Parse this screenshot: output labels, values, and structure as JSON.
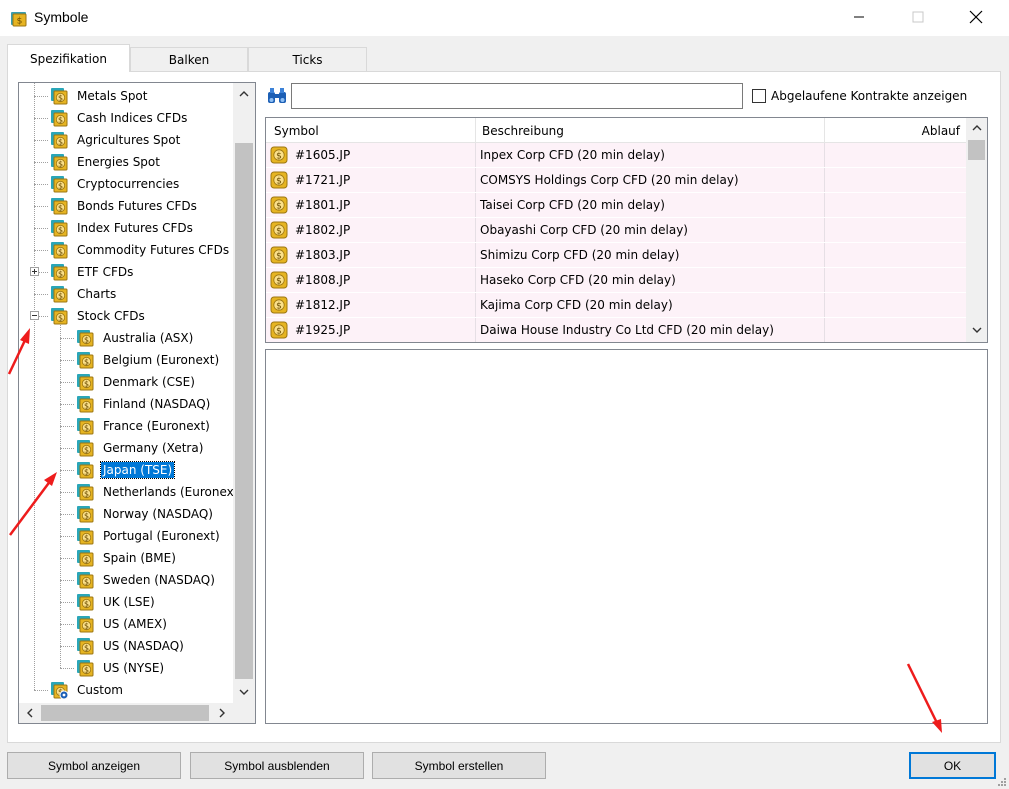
{
  "window": {
    "title": "Symbole"
  },
  "tabs": [
    {
      "label": "Spezifikation",
      "active": true
    },
    {
      "label": "Balken",
      "active": false
    },
    {
      "label": "Ticks",
      "active": false
    }
  ],
  "tree": {
    "items": [
      {
        "label": "Metals Spot",
        "level": 0
      },
      {
        "label": "Cash Indices CFDs",
        "level": 0
      },
      {
        "label": "Agricultures Spot",
        "level": 0
      },
      {
        "label": "Energies Spot",
        "level": 0
      },
      {
        "label": "Cryptocurrencies",
        "level": 0
      },
      {
        "label": "Bonds Futures CFDs",
        "level": 0
      },
      {
        "label": "Index Futures CFDs",
        "level": 0
      },
      {
        "label": "Commodity Futures CFDs",
        "level": 0
      },
      {
        "label": "ETF CFDs",
        "level": 0,
        "expander": "plus"
      },
      {
        "label": "Charts",
        "level": 0
      },
      {
        "label": "Stock CFDs",
        "level": 0,
        "expander": "minus"
      },
      {
        "label": "Australia (ASX)",
        "level": 1
      },
      {
        "label": "Belgium (Euronext)",
        "level": 1
      },
      {
        "label": "Denmark (CSE)",
        "level": 1
      },
      {
        "label": "Finland (NASDAQ)",
        "level": 1
      },
      {
        "label": "France (Euronext)",
        "level": 1
      },
      {
        "label": "Germany (Xetra)",
        "level": 1
      },
      {
        "label": "Japan (TSE)",
        "level": 1,
        "selected": true
      },
      {
        "label": "Netherlands (Euronext)",
        "level": 1
      },
      {
        "label": "Norway (NASDAQ)",
        "level": 1
      },
      {
        "label": "Portugal (Euronext)",
        "level": 1
      },
      {
        "label": "Spain (BME)",
        "level": 1
      },
      {
        "label": "Sweden (NASDAQ)",
        "level": 1
      },
      {
        "label": "UK (LSE)",
        "level": 1
      },
      {
        "label": "US (AMEX)",
        "level": 1
      },
      {
        "label": "US (NASDAQ)",
        "level": 1
      },
      {
        "label": "US (NYSE)",
        "level": 1
      },
      {
        "label": "Custom",
        "level": 0,
        "custom": true
      }
    ]
  },
  "search": {
    "value": "",
    "placeholder": ""
  },
  "expired_checkbox": {
    "label": "Abgelaufene Kontrakte anzeigen",
    "checked": false
  },
  "grid": {
    "columns": [
      "Symbol",
      "Beschreibung",
      "Ablauf"
    ],
    "rows": [
      {
        "symbol": "#1605.JP",
        "description": "Inpex Corp CFD (20 min delay)",
        "expiry": ""
      },
      {
        "symbol": "#1721.JP",
        "description": "COMSYS Holdings Corp CFD (20 min delay)",
        "expiry": ""
      },
      {
        "symbol": "#1801.JP",
        "description": "Taisei Corp CFD (20 min delay)",
        "expiry": ""
      },
      {
        "symbol": "#1802.JP",
        "description": "Obayashi Corp CFD (20 min delay)",
        "expiry": ""
      },
      {
        "symbol": "#1803.JP",
        "description": "Shimizu Corp CFD (20 min delay)",
        "expiry": ""
      },
      {
        "symbol": "#1808.JP",
        "description": "Haseko Corp CFD (20 min delay)",
        "expiry": ""
      },
      {
        "symbol": "#1812.JP",
        "description": "Kajima Corp CFD (20 min delay)",
        "expiry": ""
      },
      {
        "symbol": "#1925.JP",
        "description": "Daiwa House Industry Co Ltd CFD (20 min delay)",
        "expiry": ""
      }
    ]
  },
  "buttons": {
    "show_symbol": "Symbol anzeigen",
    "hide_symbol": "Symbol ausblenden",
    "create_symbol": "Symbol erstellen",
    "ok": "OK"
  },
  "icons": {
    "folder": "folder-dollar-icon",
    "symbol": "dollar-coin-icon",
    "search": "binoculars-icon",
    "custom": "folder-gear-icon"
  },
  "colors": {
    "selection": "#0078d7",
    "grid_row": "#fdf2f8",
    "annotation_arrow": "#ee1c1c",
    "folder_gold": "#e6b422",
    "folder_teal": "#2aa6b8"
  }
}
